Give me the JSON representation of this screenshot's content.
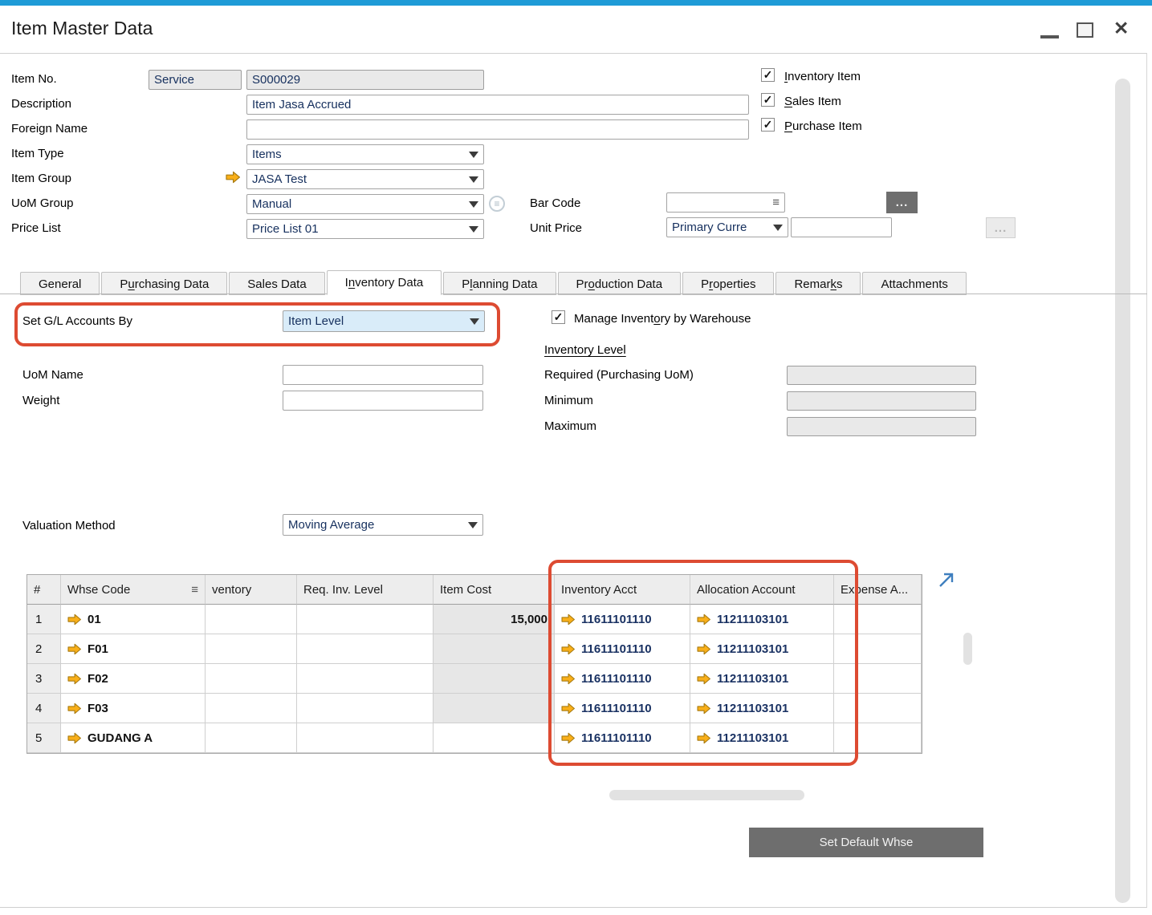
{
  "window": {
    "title": "Item Master Data"
  },
  "icons": {
    "dropdown": "▼",
    "menu": "≡",
    "check": "✓",
    "ellipsis": "...",
    "expand_arrow": "↗",
    "link_arrow": "→",
    "minimize": "–",
    "maximize": "□",
    "close": "✕"
  },
  "colors": {
    "accent": "#1E9BD7",
    "annotation_red": "#DD4B32",
    "link_arrow_orange": "#F9AF19",
    "account_text": "#1A3263"
  },
  "form": {
    "item_no": {
      "label": "Item No.",
      "type_value": "Service",
      "value": "S000029"
    },
    "description": {
      "label": "Description",
      "value": "Item Jasa Accrued"
    },
    "foreign_name": {
      "label": "Foreign Name",
      "value": ""
    },
    "item_type": {
      "label": "Item Type",
      "value": "Items"
    },
    "item_group": {
      "label": "Item Group",
      "value": "JASA Test"
    },
    "uom_group": {
      "label": "UoM Group",
      "value": "Manual"
    },
    "price_list": {
      "label": "Price List",
      "value": "Price List 01"
    },
    "bar_code": {
      "label": "Bar Code",
      "value": ""
    },
    "unit_price": {
      "label": "Unit Price",
      "currency": "Primary Curre",
      "value": ""
    },
    "checkboxes": [
      {
        "text": "Inventory Item",
        "u": 0,
        "checked": true
      },
      {
        "text": "Sales Item",
        "u": 0,
        "checked": true
      },
      {
        "text": "Purchase Item",
        "u": 0,
        "checked": true
      }
    ]
  },
  "tabs": [
    {
      "text": "General",
      "u": -1,
      "active": false
    },
    {
      "text": "Purchasing Data",
      "u": 1,
      "active": false
    },
    {
      "text": "Sales Data",
      "u": -1,
      "active": false
    },
    {
      "text": "Inventory Data",
      "u": 1,
      "active": true
    },
    {
      "text": "Planning Data",
      "u": 1,
      "active": false
    },
    {
      "text": "Production Data",
      "u": 2,
      "active": false
    },
    {
      "text": "Properties",
      "u": 1,
      "active": false
    },
    {
      "text": "Remarks",
      "u": 5,
      "active": false
    },
    {
      "text": "Attachments",
      "u": -1,
      "active": false
    }
  ],
  "inventory_tab": {
    "set_gl": {
      "label": "Set G/L Accounts By",
      "value": "Item Level"
    },
    "manage_inventory": {
      "text": "Manage Inventory by Warehouse",
      "u": 13,
      "checked": true
    },
    "inventory_level_heading": "Inventory Level",
    "required_label": "Required (Purchasing UoM)",
    "required_value": "",
    "minimum_label": "Minimum",
    "minimum_value": "",
    "maximum_label": "Maximum",
    "maximum_value": "",
    "uom_name_label": "UoM Name",
    "uom_name_value": "",
    "weight_label": "Weight",
    "weight_value": "",
    "valuation": {
      "label": "Valuation Method",
      "value": "Moving Average"
    }
  },
  "warehouse_table": {
    "columns": [
      "#",
      "Whse Code",
      "ventory",
      "Req. Inv. Level",
      "Item Cost",
      "Inventory Acct",
      "Allocation Account",
      "Expense A..."
    ],
    "rows": [
      {
        "num": "1",
        "whse_code": "01",
        "in_inventory": "",
        "req_inv_level": "",
        "item_cost": "15,000",
        "item_cost_disabled": true,
        "inventory_acct": "11611101110",
        "allocation_account": "11211103101",
        "expense": ""
      },
      {
        "num": "2",
        "whse_code": "F01",
        "in_inventory": "",
        "req_inv_level": "",
        "item_cost": "",
        "item_cost_disabled": true,
        "inventory_acct": "11611101110",
        "allocation_account": "11211103101",
        "expense": ""
      },
      {
        "num": "3",
        "whse_code": "F02",
        "in_inventory": "",
        "req_inv_level": "",
        "item_cost": "",
        "item_cost_disabled": true,
        "inventory_acct": "11611101110",
        "allocation_account": "11211103101",
        "expense": ""
      },
      {
        "num": "4",
        "whse_code": "F03",
        "in_inventory": "",
        "req_inv_level": "",
        "item_cost": "",
        "item_cost_disabled": true,
        "inventory_acct": "11611101110",
        "allocation_account": "11211103101",
        "expense": ""
      },
      {
        "num": "5",
        "whse_code": "GUDANG A",
        "in_inventory": "",
        "req_inv_level": "",
        "item_cost": "",
        "item_cost_disabled": false,
        "inventory_acct": "11611101110",
        "allocation_account": "11211103101",
        "expense": ""
      }
    ]
  },
  "footer": {
    "set_default_whse": "Set Default Whse"
  }
}
